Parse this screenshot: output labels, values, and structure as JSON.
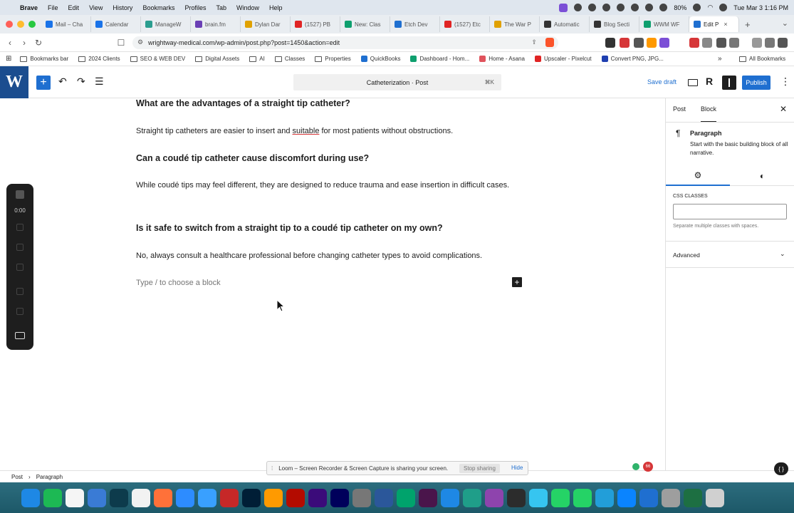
{
  "menubar": {
    "app": "Brave",
    "items": [
      "File",
      "Edit",
      "View",
      "History",
      "Bookmarks",
      "Profiles",
      "Tab",
      "Window",
      "Help"
    ],
    "battery": "80%",
    "clock": "Tue Mar 3  1:16 PM"
  },
  "tabs": [
    {
      "label": "Mail – Cha",
      "color": "#1a73e8"
    },
    {
      "label": "Calendar",
      "color": "#1a73e8"
    },
    {
      "label": "ManageW",
      "color": "#2a9d8f"
    },
    {
      "label": "brain.fm",
      "color": "#6a3fb5"
    },
    {
      "label": "Dylan Dar",
      "color": "#e0a100"
    },
    {
      "label": "(1527) PB",
      "color": "#e02424"
    },
    {
      "label": "New: Clas",
      "color": "#0e9f6e"
    },
    {
      "label": "Etch Dev",
      "color": "#1f6fd0"
    },
    {
      "label": "(1527) Etc",
      "color": "#e02424"
    },
    {
      "label": "The War P",
      "color": "#e0a100"
    },
    {
      "label": "Automatic",
      "color": "#333333"
    },
    {
      "label": "Blog Secti",
      "color": "#333333"
    },
    {
      "label": "WWM WF",
      "color": "#0e9f6e"
    },
    {
      "label": "Edit P",
      "color": "#1f6fd0",
      "active": true
    }
  ],
  "address": {
    "url": "wrightway-medical.com/wp-admin/post.php?post=1450&action=edit"
  },
  "bookmarks": [
    {
      "label": "Bookmarks bar",
      "type": "folder"
    },
    {
      "label": "2024 Clients",
      "type": "folder"
    },
    {
      "label": "SEO & WEB DEV",
      "type": "folder"
    },
    {
      "label": "Digital Assets",
      "type": "folder"
    },
    {
      "label": "AI",
      "type": "folder"
    },
    {
      "label": "Classes",
      "type": "folder"
    },
    {
      "label": "Properties",
      "type": "folder"
    },
    {
      "label": "QuickBooks",
      "type": "site",
      "color": "#1f6fd0"
    },
    {
      "label": "Dashboard - Hom...",
      "type": "site",
      "color": "#0e9f6e"
    },
    {
      "label": "Home - Asana",
      "type": "site",
      "color": "#e0535c"
    },
    {
      "label": "Upscaler - Pixelcut",
      "type": "site",
      "color": "#e02424"
    },
    {
      "label": "Convert PNG, JPG...",
      "type": "site",
      "color": "#1f3fb0"
    }
  ],
  "bookmarks_all": "All Bookmarks",
  "wp": {
    "logo": "W",
    "command": "Catheterization · Post",
    "shortcut": "⌘K",
    "save_draft": "Save draft",
    "publish": "Publish"
  },
  "content": {
    "h1": "What are the advantages of a straight tip catheter?",
    "p1_before": "Straight tip catheters are easier to insert and ",
    "p1_underlined": "suitable",
    "p1_after": " for most patients without obstructions.",
    "h2": "Can a coudé tip catheter cause discomfort during use?",
    "p2": "While coudé tips may feel different, they are designed to reduce trauma and ease insertion in difficult cases.",
    "h3": "Is it safe to switch from a straight tip to a coudé tip catheter on my own?",
    "p3": "No, always consult a healthcare professional before changing catheter types to avoid complications.",
    "placeholder": "Type / to choose a block"
  },
  "loom_panel": {
    "time": "0:00"
  },
  "sidebar": {
    "tab_post": "Post",
    "tab_block": "Block",
    "block_name": "Paragraph",
    "block_desc": "Start with the basic building block of all narrative.",
    "css_label": "CSS CLASSES",
    "css_value": "",
    "css_help": "Separate multiple classes with spaces.",
    "advanced": "Advanced"
  },
  "footer": {
    "crumb1": "Post",
    "crumb2": "Paragraph"
  },
  "loom_notice": {
    "text": "Loom – Screen Recorder & Screen Capture is sharing your screen.",
    "stop": "Stop sharing",
    "hide": "Hide"
  },
  "badge": "66",
  "dock_colors": [
    "#1e88e5",
    "#1db954",
    "#f5f5f5",
    "#3a7bd5",
    "#0d3b4c",
    "#f2f2f2",
    "#ff7139",
    "#2d8cff",
    "#39a0ff",
    "#c62828",
    "#001e36",
    "#ff9a00",
    "#b30b00",
    "#3b0b7a",
    "#00005b",
    "#777777",
    "#2b579a",
    "#00a36c",
    "#4a154b",
    "#1e88e5",
    "#1f9e89",
    "#8e44ad",
    "#2c2c2c",
    "#36c5f0",
    "#25d366",
    "#25d366",
    "#229ed9",
    "#0a84ff",
    "#1f6fd0",
    "#9e9e9e",
    "#1d6f42",
    "#d0d0d0"
  ]
}
